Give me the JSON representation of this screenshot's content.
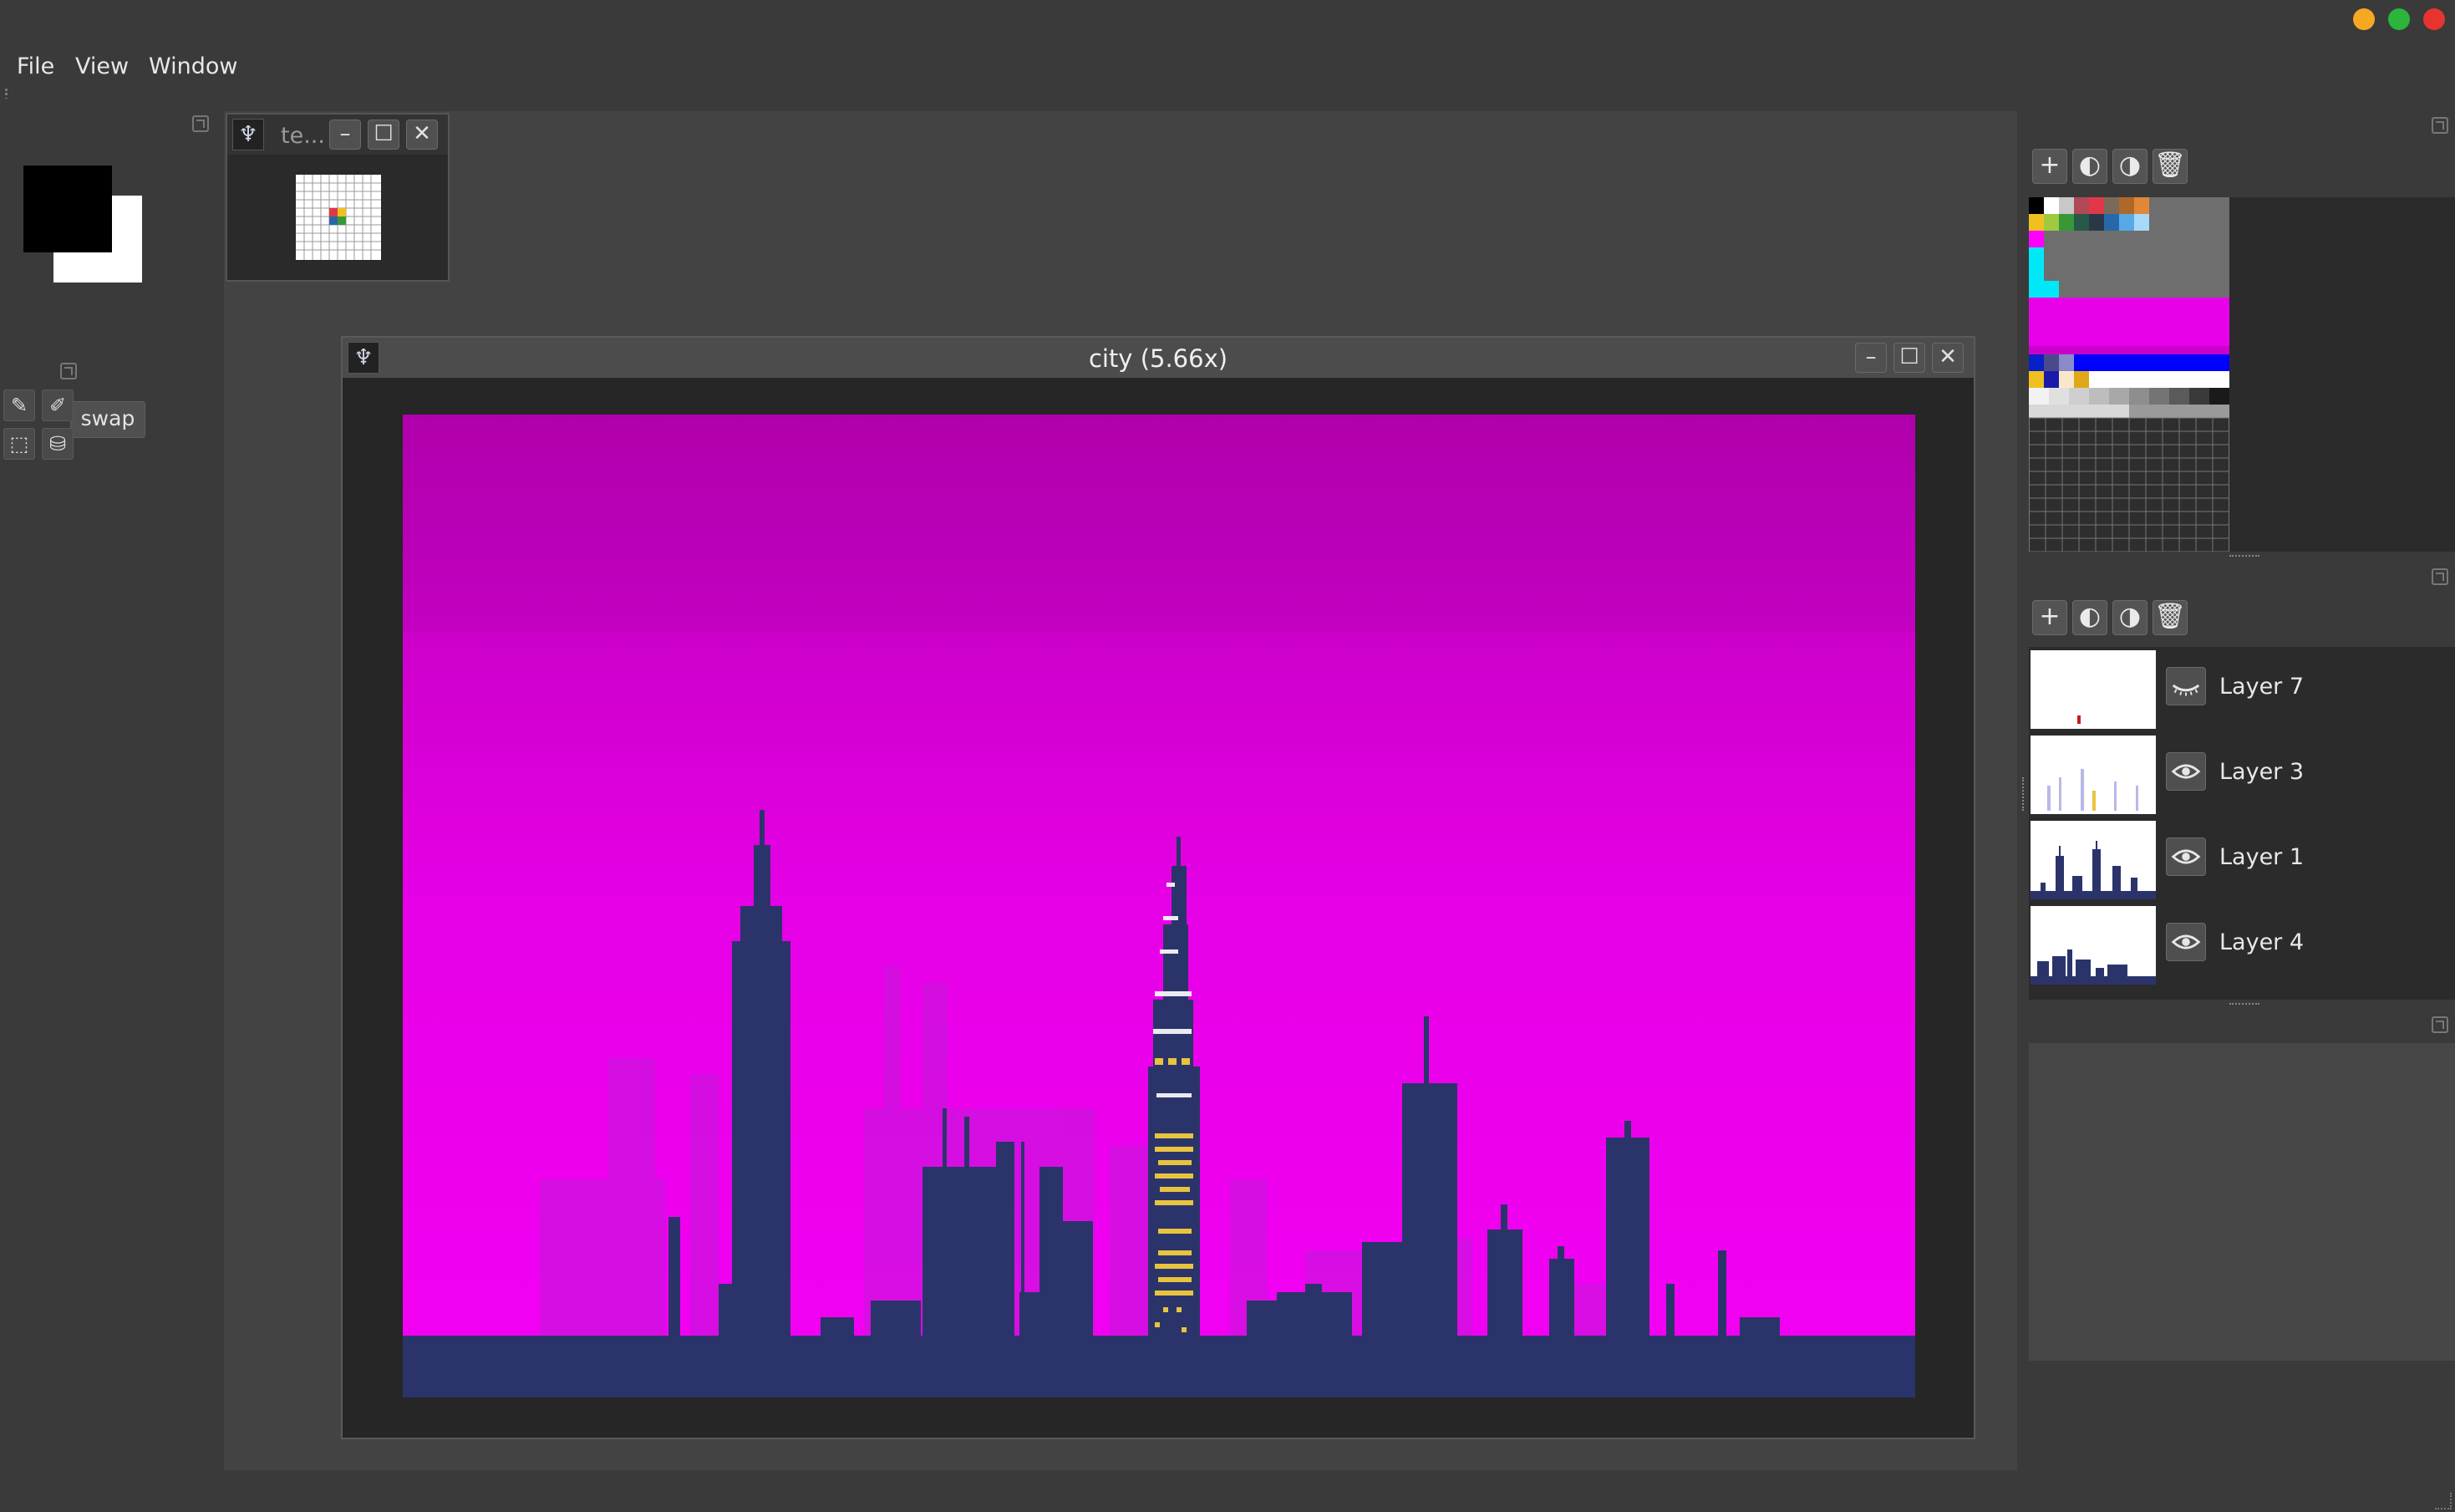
{
  "window_controls": {
    "minimize_color": "#f7a823",
    "zoom_color": "#2bb53a",
    "close_color": "#e7342f"
  },
  "menu": {
    "items": [
      "File",
      "View",
      "Window"
    ]
  },
  "tools": {
    "swap_label": "swap",
    "foreground_color": "#000000",
    "background_color": "#ffffff",
    "tool_icons": [
      "pencil-icon",
      "eyedropper-icon",
      "select-rect-icon",
      "bucket-icon"
    ]
  },
  "sprite_window": {
    "title": "te...",
    "buttons": {
      "minimize": "–",
      "maximize": "☐",
      "close": "✕"
    }
  },
  "city_window": {
    "title": "city (5.66x)",
    "buttons": {
      "minimize": "–",
      "maximize": "☐",
      "close": "✕"
    },
    "sky_colors": {
      "top": "#b800b4",
      "bottom": "#f400f4"
    },
    "building_color": "#2b346a",
    "window_light_color": "#e8c43e"
  },
  "palette_panel": {
    "button_icons": [
      "plus-icon",
      "import-icon",
      "export-icon",
      "trash-icon"
    ],
    "accent_colors": [
      "#000000",
      "#ffffff",
      "#c8c8c8",
      "#b04858",
      "#e03848",
      "#7a6a5a",
      "#e08838",
      "#f0c020",
      "#a0c840",
      "#389838",
      "#285848",
      "#2868a8",
      "#58a8e8",
      "#ff00ff",
      "#00e8f8",
      "#0000ff"
    ]
  },
  "layers_panel": {
    "button_icons": [
      "plus-icon",
      "merge-down-icon",
      "merge-up-icon",
      "trash-icon"
    ],
    "layers": [
      {
        "name": "Layer 7",
        "visible": false
      },
      {
        "name": "Layer 3",
        "visible": true
      },
      {
        "name": "Layer 1",
        "visible": true
      },
      {
        "name": "Layer 4",
        "visible": true
      }
    ]
  }
}
